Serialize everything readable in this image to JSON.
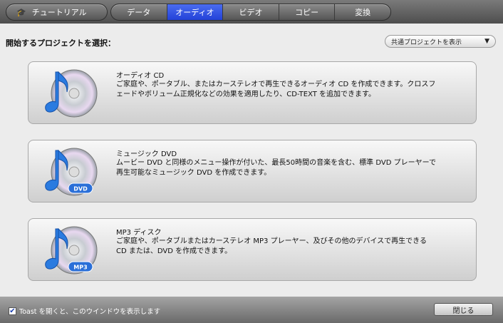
{
  "toolbar": {
    "tutorial": "チュートリアル",
    "tabs": [
      "データ",
      "オーディオ",
      "ビデオ",
      "コピー",
      "変換"
    ],
    "active_tab": "オーディオ"
  },
  "main": {
    "prompt": "開始するプロジェクトを選択：",
    "filter": "共通プロジェクトを表示"
  },
  "projects": [
    {
      "title": "オーディオ CD",
      "desc": "ご家庭や、ポータブル、またはカーステレオで再生できるオーディオ CD を作成できます。クロスフェードやボリューム正規化などの効果を適用したり、CD-TEXT を追加できます。",
      "badge": ""
    },
    {
      "title": "ミュージック DVD",
      "desc": "ムービー DVD と同様のメニュー操作が付いた、最長50時間の音楽を含む、標準 DVD プレーヤーで再生可能なミュージック DVD を作成できます。",
      "badge": "DVD"
    },
    {
      "title": "MP3 ディスク",
      "desc": "ご家庭や、ポータブルまたはカーステレオ MP3 プレーヤー、及びその他のデバイスで再生できる CD または、DVD を作成できます。",
      "badge": "MP3"
    }
  ],
  "footer": {
    "show_on_open": "Toast を開くと、このウインドウを表示します",
    "checked": true,
    "close": "閉じる"
  }
}
